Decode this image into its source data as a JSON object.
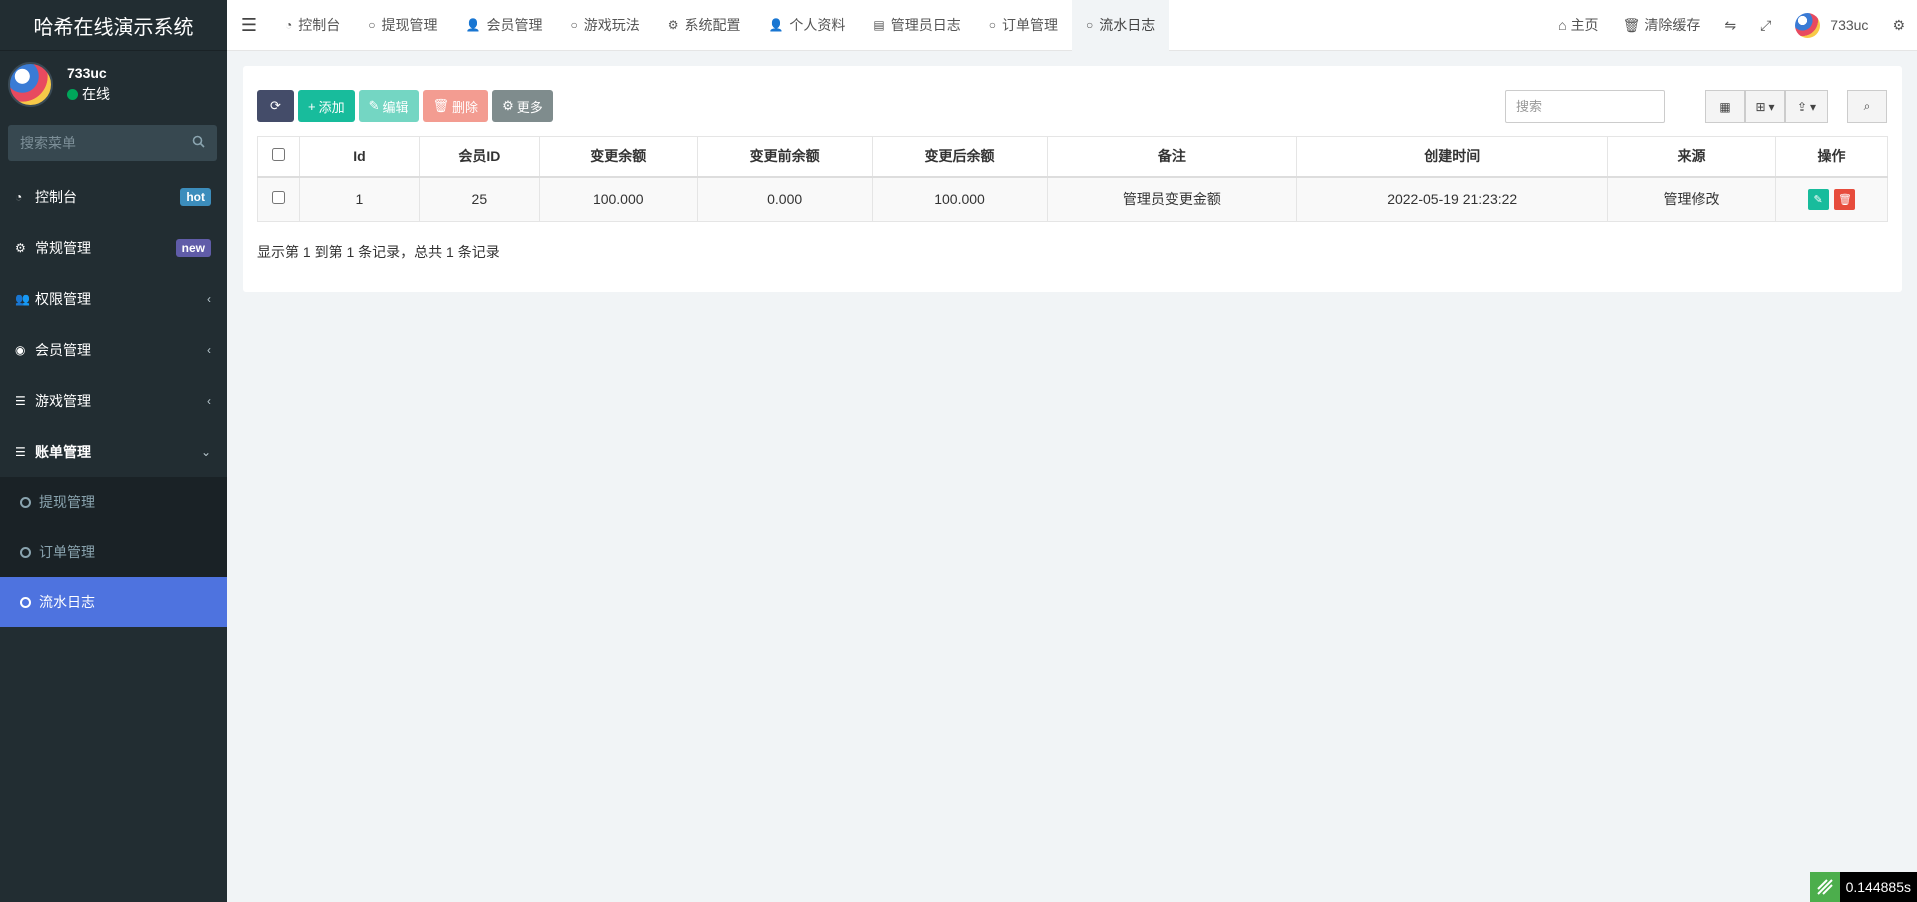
{
  "sidebar": {
    "brand": "哈希在线演示系统",
    "user": {
      "name": "733uc",
      "status": "在线"
    },
    "search_placeholder": "搜索菜单",
    "items": [
      {
        "icon": "dashboard-icon",
        "label": "控制台",
        "badge": "hot"
      },
      {
        "icon": "cogs-icon",
        "label": "常规管理",
        "badge": "new"
      },
      {
        "icon": "users-icon",
        "label": "权限管理"
      },
      {
        "icon": "user-circle-icon",
        "label": "会员管理"
      },
      {
        "icon": "list-icon",
        "label": "游戏管理"
      },
      {
        "icon": "list-icon",
        "label": "账单管理"
      }
    ],
    "subitems": [
      {
        "label": "提现管理"
      },
      {
        "label": "订单管理"
      },
      {
        "label": "流水日志"
      }
    ]
  },
  "topbar": {
    "tabs": [
      {
        "icon": "dashboard-icon",
        "label": "控制台"
      },
      {
        "icon": "circle-icon",
        "label": "提现管理"
      },
      {
        "icon": "user-icon",
        "label": "会员管理"
      },
      {
        "icon": "circle-icon",
        "label": "游戏玩法"
      },
      {
        "icon": "gear-icon",
        "label": "系统配置"
      },
      {
        "icon": "user-icon",
        "label": "个人资料"
      },
      {
        "icon": "list-alt-icon",
        "label": "管理员日志"
      },
      {
        "icon": "circle-icon",
        "label": "订单管理"
      },
      {
        "icon": "circle-icon",
        "label": "流水日志"
      }
    ],
    "home_label": "主页",
    "clear_cache_label": "清除缓存",
    "username": "733uc"
  },
  "toolbar": {
    "add_label": "添加",
    "edit_label": "编辑",
    "delete_label": "删除",
    "more_label": "更多",
    "search_placeholder": "搜索"
  },
  "table": {
    "headers": [
      "Id",
      "会员ID",
      "变更余额",
      "变更前余额",
      "变更后余额",
      "备注",
      "创建时间",
      "来源",
      "操作"
    ],
    "rows": [
      {
        "id": "1",
        "member_id": "25",
        "change": "100.000",
        "before": "0.000",
        "after": "100.000",
        "remark": "管理员变更金额",
        "created": "2022-05-19 21:23:22",
        "source": "管理修改"
      }
    ]
  },
  "pagination": {
    "info": "显示第 1 到第 1 条记录，总共 1 条记录"
  },
  "timer": {
    "value": "0.144885s"
  },
  "colors": {
    "sidebar_bg": "#222d32",
    "active_item": "#4e73df",
    "add_green": "#18bc9c",
    "danger_red": "#e74c3c"
  }
}
